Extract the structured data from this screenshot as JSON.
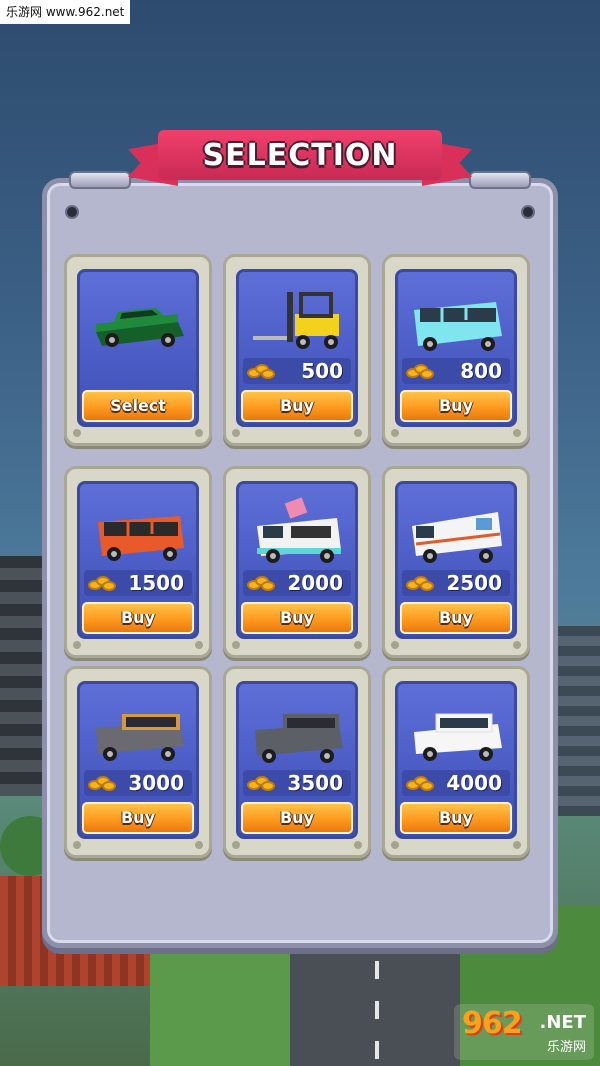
{
  "watermark": {
    "top_left": "乐游网 www.962.net",
    "logo": "962",
    "logo_suffix": ".NET",
    "logo_cn": "乐游网"
  },
  "title": "SELECTION",
  "colors": {
    "banner": "#e6365f",
    "panel": "#b5b7cf",
    "card_inner": "#4d5ec8",
    "button": "#ff9a1e"
  },
  "vehicles": [
    {
      "icon": "green-sedan-icon",
      "price": "",
      "button": "Select",
      "color": "#1f8a3a"
    },
    {
      "icon": "yellow-forklift-icon",
      "price": "500",
      "button": "Buy",
      "color": "#f2d21c"
    },
    {
      "icon": "cyan-van-icon",
      "price": "800",
      "button": "Buy",
      "color": "#7fe5ef"
    },
    {
      "icon": "orange-van-icon",
      "price": "1500",
      "button": "Buy",
      "color": "#e85a2a"
    },
    {
      "icon": "ice-cream-truck-icon",
      "price": "2000",
      "button": "Buy",
      "color": "#f2f2f2"
    },
    {
      "icon": "white-delivery-truck-icon",
      "price": "2500",
      "button": "Buy",
      "color": "#f4f4f4"
    },
    {
      "icon": "vintage-wagon-icon",
      "price": "3000",
      "button": "Buy",
      "color": "#6a6a70"
    },
    {
      "icon": "gray-jeep-icon",
      "price": "3500",
      "button": "Buy",
      "color": "#5c5f66"
    },
    {
      "icon": "white-suv-icon",
      "price": "4000",
      "button": "Buy",
      "color": "#f6f6f6"
    }
  ]
}
